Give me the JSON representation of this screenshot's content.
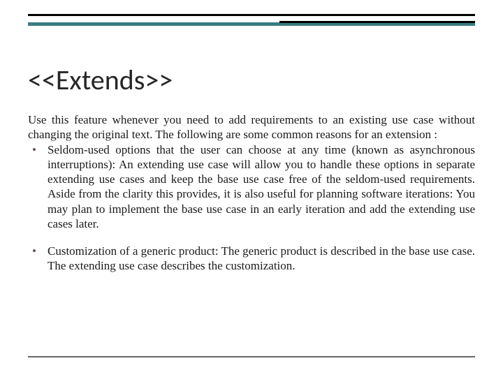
{
  "title": "<<Extends>>",
  "intro": "Use this feature whenever you need to add requirements to an existing use case without changing the original text. The following are some common reasons for an extension :",
  "bullets": [
    "Seldom-used options that the user can choose at any time (known as asynchronous interruptions): An extending use case will allow you to handle these options in separate extending use cases and keep the base use case free of the seldom-used requirements. Aside from the clarity this provides, it is also useful for planning software iterations: You may plan to implement the base use case in an early iteration and add the extending use cases later.",
    "Customization of a generic product: The generic product is described in the base use case. The extending use case describes the customization."
  ]
}
